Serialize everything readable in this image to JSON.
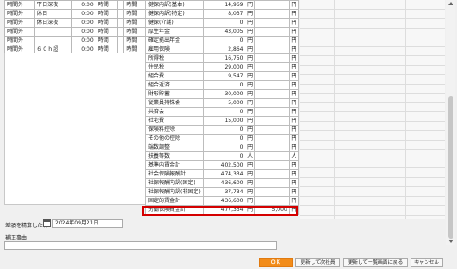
{
  "left_rows": [
    {
      "label": "時間外",
      "sub": "平日深夜",
      "val": "0:00",
      "u1": "時間",
      "u2": "時間"
    },
    {
      "label": "時間外",
      "sub": "休日",
      "val": "0:00",
      "u1": "時間",
      "u2": "時間"
    },
    {
      "label": "時間外",
      "sub": "休日深夜",
      "val": "0:00",
      "u1": "時間",
      "u2": "時間"
    },
    {
      "label": "時間外",
      "sub": "",
      "val": "0:00",
      "u1": "時間",
      "u2": "時間"
    },
    {
      "label": "時間外",
      "sub": "",
      "val": "0:00",
      "u1": "時間",
      "u2": "時間"
    },
    {
      "label": "時間外",
      "sub": "６０ｈ超",
      "val": "0:00",
      "u1": "時間",
      "u2": "時間"
    }
  ],
  "mid_rows": [
    {
      "name": "健保内訳(基本)",
      "v1": "14,969",
      "u1": "円",
      "v2": "",
      "u2": "円"
    },
    {
      "name": "健保内訳(特定)",
      "v1": "8,037",
      "u1": "円",
      "v2": "",
      "u2": "円"
    },
    {
      "name": "健保(介護)",
      "v1": "0",
      "u1": "円",
      "v2": "",
      "u2": "円"
    },
    {
      "name": "厚生年金",
      "v1": "43,005",
      "u1": "円",
      "v2": "",
      "u2": "円"
    },
    {
      "name": "確定拠出年金",
      "v1": "0",
      "u1": "円",
      "v2": "",
      "u2": "円"
    },
    {
      "name": "雇用保険",
      "v1": "2,864",
      "u1": "円",
      "v2": "",
      "u2": "円"
    },
    {
      "name": "所得税",
      "v1": "16,750",
      "u1": "円",
      "v2": "",
      "u2": "円"
    },
    {
      "name": "住民税",
      "v1": "29,000",
      "u1": "円",
      "v2": "",
      "u2": "円"
    },
    {
      "name": "組合費",
      "v1": "9,547",
      "u1": "円",
      "v2": "",
      "u2": "円"
    },
    {
      "name": "組合返済",
      "v1": "0",
      "u1": "円",
      "v2": "",
      "u2": "円"
    },
    {
      "name": "財形貯蓄",
      "v1": "30,000",
      "u1": "円",
      "v2": "",
      "u2": "円"
    },
    {
      "name": "従業員持株会",
      "v1": "5,000",
      "u1": "円",
      "v2": "",
      "u2": "円"
    },
    {
      "name": "共済会",
      "v1": "0",
      "u1": "円",
      "v2": "",
      "u2": "円"
    },
    {
      "name": "社宅費",
      "v1": "15,000",
      "u1": "円",
      "v2": "",
      "u2": "円"
    },
    {
      "name": "保険料控除",
      "v1": "0",
      "u1": "円",
      "v2": "",
      "u2": "円"
    },
    {
      "name": "その他の控除",
      "v1": "0",
      "u1": "円",
      "v2": "",
      "u2": "円"
    },
    {
      "name": "端数調整",
      "v1": "0",
      "u1": "円",
      "v2": "",
      "u2": "円"
    },
    {
      "name": "扶養等数",
      "v1": "0",
      "u1": "人",
      "v2": "",
      "u2": "人"
    },
    {
      "name": "基準内賃金計",
      "v1": "402,500",
      "u1": "円",
      "v2": "",
      "u2": "円"
    },
    {
      "name": "社会保険報酬計",
      "v1": "474,334",
      "u1": "円",
      "v2": "",
      "u2": "円"
    },
    {
      "name": "社保報酬内訳(固定)",
      "v1": "436,600",
      "u1": "円",
      "v2": "",
      "u2": "円"
    },
    {
      "name": "社保報酬内訳(非固定)",
      "v1": "37,734",
      "u1": "円",
      "v2": "",
      "u2": "円"
    },
    {
      "name": "固定的賃金計",
      "v1": "436,600",
      "u1": "円",
      "v2": "",
      "u2": "円"
    },
    {
      "name": "労働保険賃金計",
      "v1": "477,334",
      "u1": "円",
      "v2": "5,000",
      "u2": "円"
    }
  ],
  "date_label": "差額を精算した日",
  "date_value": "2024年09月21日",
  "reason_label": "補正事由",
  "buttons": {
    "ok": "ＯＫ",
    "update_next": "更新して次社員",
    "update_back": "更新して一覧画面に戻る",
    "cancel": "キャンセル"
  }
}
